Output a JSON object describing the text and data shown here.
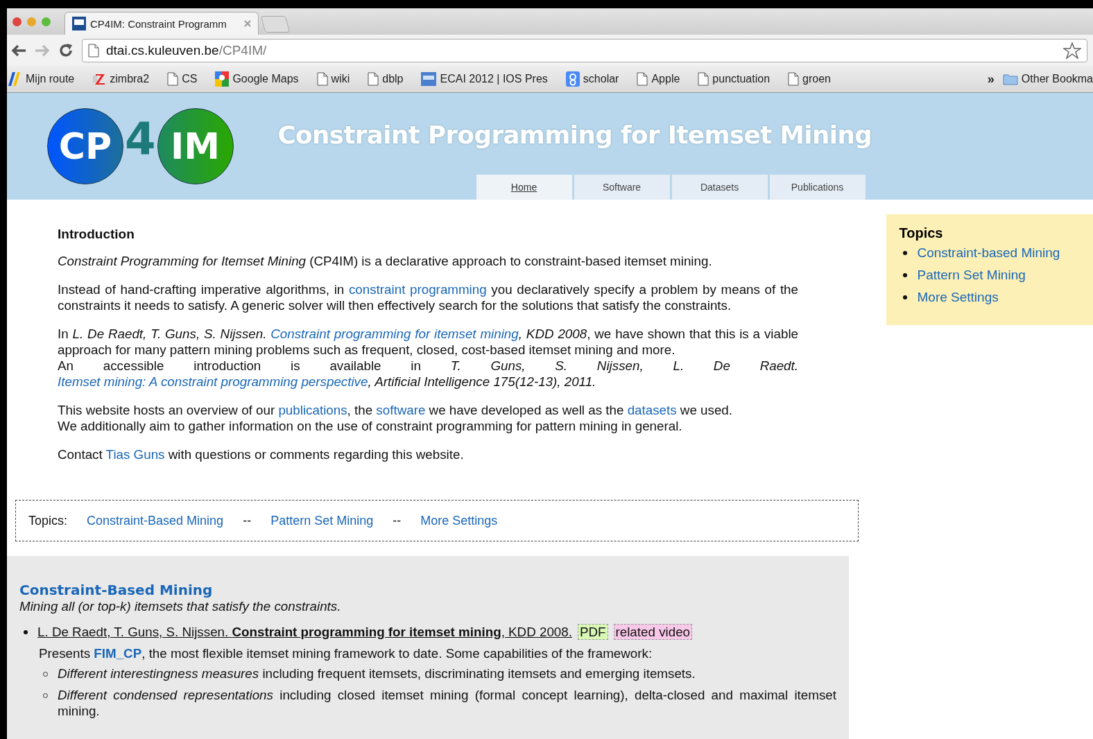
{
  "browser": {
    "tabs": [
      {
        "title": "CP4IM: Constraint Programm",
        "selected": true
      }
    ],
    "url_host": "dtai.cs.kuleuven.be",
    "url_path": "/CP4IM/",
    "bookmarks": [
      {
        "label": "Mijn route",
        "kind": "route"
      },
      {
        "label": "zimbra2",
        "kind": "zimbra"
      },
      {
        "label": "CS",
        "kind": "page"
      },
      {
        "label": "Google Maps",
        "kind": "maps"
      },
      {
        "label": "wiki",
        "kind": "page"
      },
      {
        "label": "dblp",
        "kind": "page"
      },
      {
        "label": "ECAI 2012 | IOS Pres",
        "kind": "ios"
      },
      {
        "label": "scholar",
        "kind": "scholar"
      },
      {
        "label": "Apple",
        "kind": "page"
      },
      {
        "label": "punctuation",
        "kind": "page"
      },
      {
        "label": "groen",
        "kind": "page"
      }
    ],
    "overflow": "»",
    "other_bookmarks": "Other Bookma"
  },
  "site": {
    "logo": {
      "left": "CP",
      "middle": "4",
      "right": "IM"
    },
    "title": "Constraint Programming for Itemset Mining",
    "nav": [
      {
        "label": "Home",
        "selected": true
      },
      {
        "label": "Software",
        "selected": false
      },
      {
        "label": "Datasets",
        "selected": false
      },
      {
        "label": "Publications",
        "selected": false
      }
    ]
  },
  "intro": {
    "heading": "Introduction",
    "paragraphs": [
      {
        "lines": [
          [
            {
              "text": "*Constraint Programming for Itemset Mining* (CP4IM) is a declarative approach to constraint-based itemset mining.",
              "link": false
            }
          ]
        ]
      },
      {
        "lines": [
          [
            {
              "text": "Instead of hand-crafting imperative algorithms, in ",
              "link": false
            },
            {
              "text": "constraint programming",
              "link": true
            },
            {
              "text": " you declaratively specify a problem by means of the constraints it needs to satisfy. A generic solver will then effectively search for the solutions that satisfy the constraints.",
              "link": false
            }
          ]
        ]
      },
      {
        "lines": [
          [
            {
              "text": "In *L. De Raedt, T. Guns, S. Nijssen.* ",
              "link": false
            },
            {
              "text": "*Constraint programming for itemset mining*",
              "link": true
            },
            {
              "text": "*, KDD 2008*, we have shown that this is a viable approach for many pattern mining problems such as frequent, closed, cost-based itemset mining and more.",
              "link": false
            }
          ],
          [
            {
              "text": "An accessible introduction is available in *T. Guns, S. Nijssen, L. De Raedt.* ",
              "link": false
            },
            {
              "text": "*Itemset mining: A constraint programming perspective*",
              "link": true
            },
            {
              "text": "*, Artificial Intelligence 175(12-13), 2011.*",
              "link": false
            }
          ]
        ]
      },
      {
        "lines": [
          [
            {
              "text": "This website hosts an overview of our ",
              "link": false
            },
            {
              "text": "publications",
              "link": true
            },
            {
              "text": ", the ",
              "link": false
            },
            {
              "text": "software",
              "link": true
            },
            {
              "text": " we have developed as well as the ",
              "link": false
            },
            {
              "text": "datasets",
              "link": true
            },
            {
              "text": " we used.",
              "link": false
            }
          ],
          [
            {
              "text": "We additionally aim to gather information on the use of constraint programming for pattern mining in general.",
              "link": false
            }
          ]
        ]
      },
      {
        "lines": [
          [
            {
              "text": "Contact ",
              "link": false
            },
            {
              "text": "Tias Guns",
              "link": true
            },
            {
              "text": " with questions or comments regarding this website.",
              "link": false
            }
          ]
        ]
      }
    ]
  },
  "sidebar": {
    "heading": "Topics",
    "items": [
      "Constraint-based Mining",
      "Pattern Set Mining",
      "More Settings"
    ]
  },
  "topics_bar": {
    "label": "Topics:",
    "items": [
      {
        "kind": "link",
        "text": "Constraint-Based Mining"
      },
      {
        "kind": "separator",
        "text": "--"
      },
      {
        "kind": "link",
        "text": "Pattern Set Mining"
      },
      {
        "kind": "separator",
        "text": "--"
      },
      {
        "kind": "link",
        "text": "More Settings"
      }
    ]
  },
  "section": {
    "title": "Constraint-Based Mining",
    "subtitle": "Mining all (or top-k) itemsets that satisfy the constraints.",
    "publications": [
      {
        "citation": "L. De Raedt, T. Guns, S. Nijssen. **Constraint programming for itemset mining**, KDD 2008.",
        "badges": [
          {
            "kind": "pdf",
            "label": "PDF"
          },
          {
            "kind": "video",
            "label": "related video"
          }
        ],
        "description": [
          {
            "text": "Presents ",
            "link": false
          },
          {
            "text": "FIM_CP",
            "link": true
          },
          {
            "text": ", the most flexible itemset mining framework to date. Some capabilities of the framework:",
            "link": false
          }
        ],
        "features": [
          "*Different interestingness measures* including frequent itemsets, discriminating itemsets and emerging itemsets.",
          "*Different condensed representations* including closed itemset mining (formal concept learning), delta-closed and maximal itemset mining."
        ]
      }
    ]
  }
}
